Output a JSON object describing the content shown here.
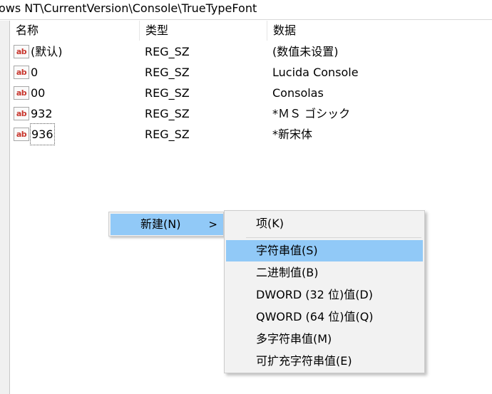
{
  "address": {
    "path": "ows NT\\CurrentVersion\\Console\\TrueTypeFont"
  },
  "columns": {
    "name": "名称",
    "type": "类型",
    "data": "数据"
  },
  "rows": [
    {
      "name": "(默认)",
      "type": "REG_SZ",
      "data": "(数值未设置)",
      "icon": "ab"
    },
    {
      "name": "0",
      "type": "REG_SZ",
      "data": "Lucida Console",
      "icon": "ab"
    },
    {
      "name": "00",
      "type": "REG_SZ",
      "data": "Consolas",
      "icon": "ab"
    },
    {
      "name": "932",
      "type": "REG_SZ",
      "data": "*ＭＳ ゴシック",
      "icon": "ab"
    },
    {
      "name": "936",
      "type": "REG_SZ",
      "data": "*新宋体",
      "icon": "ab"
    }
  ],
  "context_menu": {
    "new_label": "新建(N)",
    "arrow": ">",
    "submenu": [
      {
        "label": "项(K)"
      },
      {
        "label": "字符串值(S)"
      },
      {
        "label": "二进制值(B)"
      },
      {
        "label": "DWORD (32 位)值(D)"
      },
      {
        "label": "QWORD (64 位)值(Q)"
      },
      {
        "label": "多字符串值(M)"
      },
      {
        "label": "可扩充字符串值(E)"
      }
    ]
  },
  "colors": {
    "highlight": "#91c9f7",
    "menu_bg": "#f2f2f2",
    "icon_text": "#c8362d"
  }
}
